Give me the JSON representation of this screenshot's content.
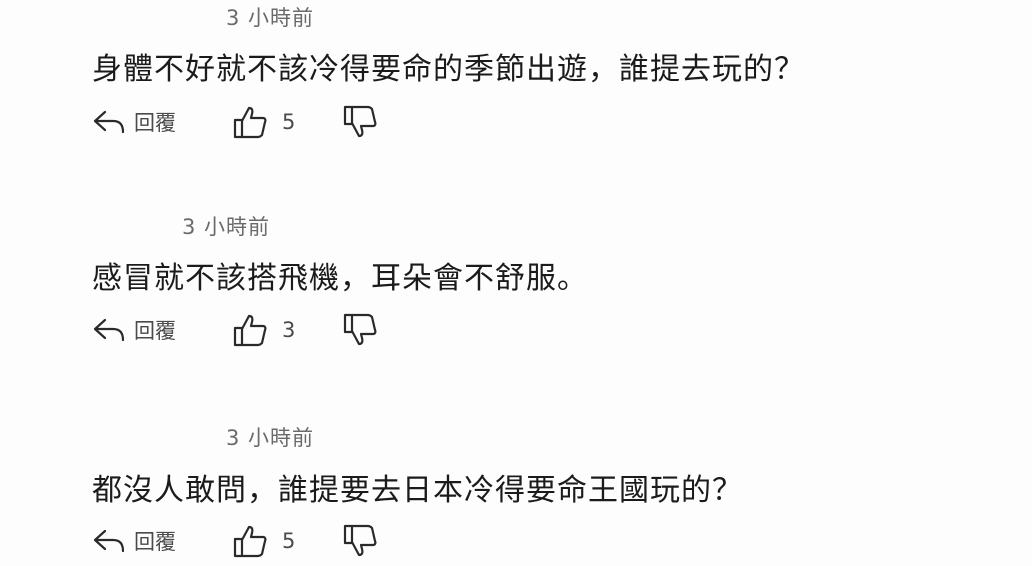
{
  "comments": [
    {
      "timestamp": "3 小時前",
      "text": "身體不好就不該冷得要命的季節出遊，誰提去玩的？",
      "reply_label": "回覆",
      "like_count": "5"
    },
    {
      "timestamp": "3 小時前",
      "text": "感冒就不該搭飛機，耳朵會不舒服。",
      "reply_label": "回覆",
      "like_count": "3"
    },
    {
      "timestamp": "3 小時前",
      "text": "都沒人敢問，誰提要去日本冷得要命王國玩的？",
      "reply_label": "回覆",
      "like_count": "5"
    }
  ],
  "icons": {
    "reply": "reply-arrow-icon",
    "like": "thumbs-up-icon",
    "dislike": "thumbs-down-icon"
  }
}
